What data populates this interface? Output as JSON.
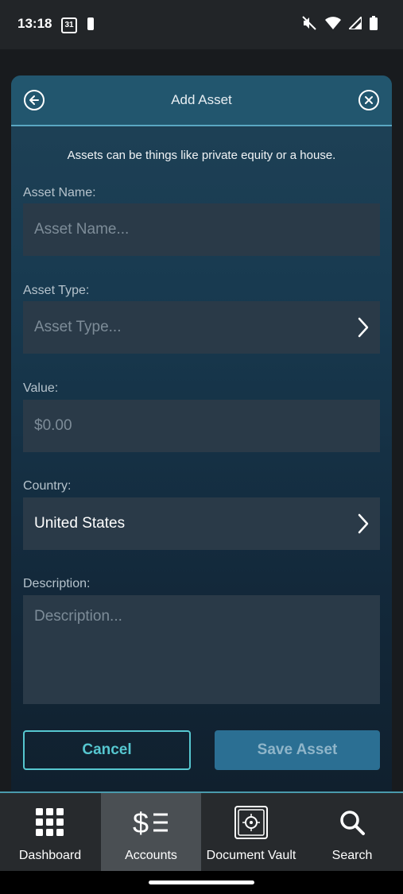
{
  "status_bar": {
    "time": "13:18",
    "calendar_day": "31"
  },
  "modal": {
    "title": "Add Asset",
    "hint": "Assets can be things like private equity or a house.",
    "fields": {
      "asset_name": {
        "label": "Asset Name:",
        "placeholder": "Asset Name..."
      },
      "asset_type": {
        "label": "Asset Type:",
        "placeholder": "Asset Type..."
      },
      "value": {
        "label": "Value:",
        "placeholder": "$0.00"
      },
      "country": {
        "label": "Country:",
        "value": "United States"
      },
      "description": {
        "label": "Description:",
        "placeholder": "Description..."
      }
    },
    "buttons": {
      "cancel": "Cancel",
      "save": "Save Asset"
    }
  },
  "tabbar": {
    "items": [
      {
        "label": "Dashboard",
        "icon": "grid-icon"
      },
      {
        "label": "Accounts",
        "icon": "dollar-list-icon",
        "active": true
      },
      {
        "label": "Document Vault",
        "icon": "vault-icon"
      },
      {
        "label": "Search",
        "icon": "search-icon"
      }
    ]
  },
  "colors": {
    "header": "#22566e",
    "accent": "#56c7d0",
    "save_button": "#2b6f93",
    "field_bg": "#2a3a48"
  }
}
